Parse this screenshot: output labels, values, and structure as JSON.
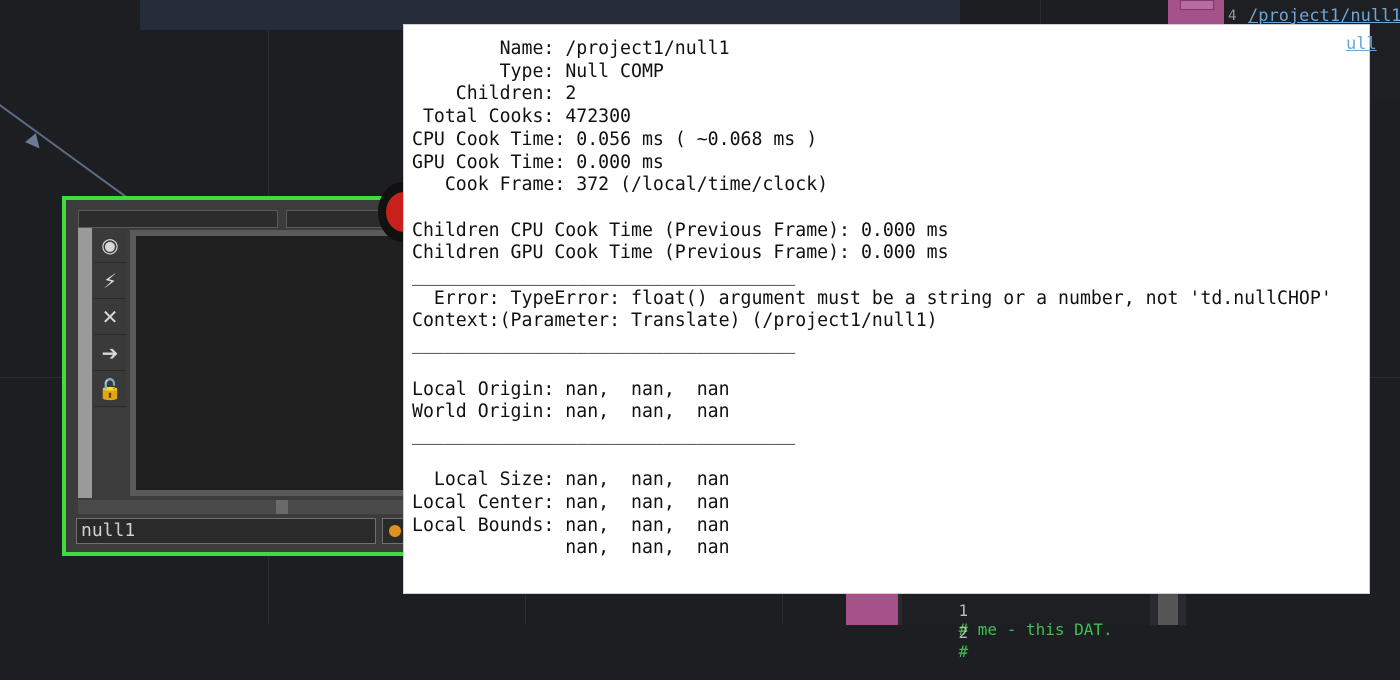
{
  "node": {
    "name": "null1",
    "icons": [
      "viewer-icon",
      "bypass-icon",
      "close-icon",
      "arrow-right-icon",
      "lock-icon"
    ],
    "flag_color": "#e0901c",
    "border_color": "#3fdc3f"
  },
  "dat_top": {
    "line_number": "4",
    "line_text": "/project1/null1",
    "line_text_2": "ull"
  },
  "dat_bottom": {
    "line1_no": "1",
    "line1_text": "# me - this DAT.",
    "line2_no": "2",
    "line2_text": "#"
  },
  "info_popup": {
    "general": {
      "name_label": "        Name:",
      "name_value": "/project1/null1",
      "type_label": "        Type:",
      "type_value": "Null COMP",
      "children_label": "    Children:",
      "children_value": "2",
      "total_cooks_label": " Total Cooks:",
      "total_cooks_value": "472300",
      "cpu_label": "CPU Cook Time:",
      "cpu_value": "0.056 ms ( ~0.068 ms )",
      "gpu_label": "GPU Cook Time:",
      "gpu_value": "0.000 ms",
      "frame_label": "   Cook Frame:",
      "frame_value": "372 (/local/time/clock)"
    },
    "children_cpu": "Children CPU Cook Time (Previous Frame): 0.000 ms",
    "children_gpu": "Children GPU Cook Time (Previous Frame): 0.000 ms",
    "separator": "___________________________________",
    "error_line": "  Error: TypeError: float() argument must be a string or a number, not 'td.nullCHOP'",
    "context_line": "Context:(Parameter: Translate) (/project1/null1)",
    "local_origin": "Local Origin: nan,  nan,  nan",
    "world_origin": "World Origin: nan,  nan,  nan",
    "local_size": "  Local Size: nan,  nan,  nan",
    "local_center": "Local Center: nan,  nan,  nan",
    "local_bounds": "Local Bounds: nan,  nan,  nan",
    "local_bounds_2": "              nan,  nan,  nan"
  }
}
